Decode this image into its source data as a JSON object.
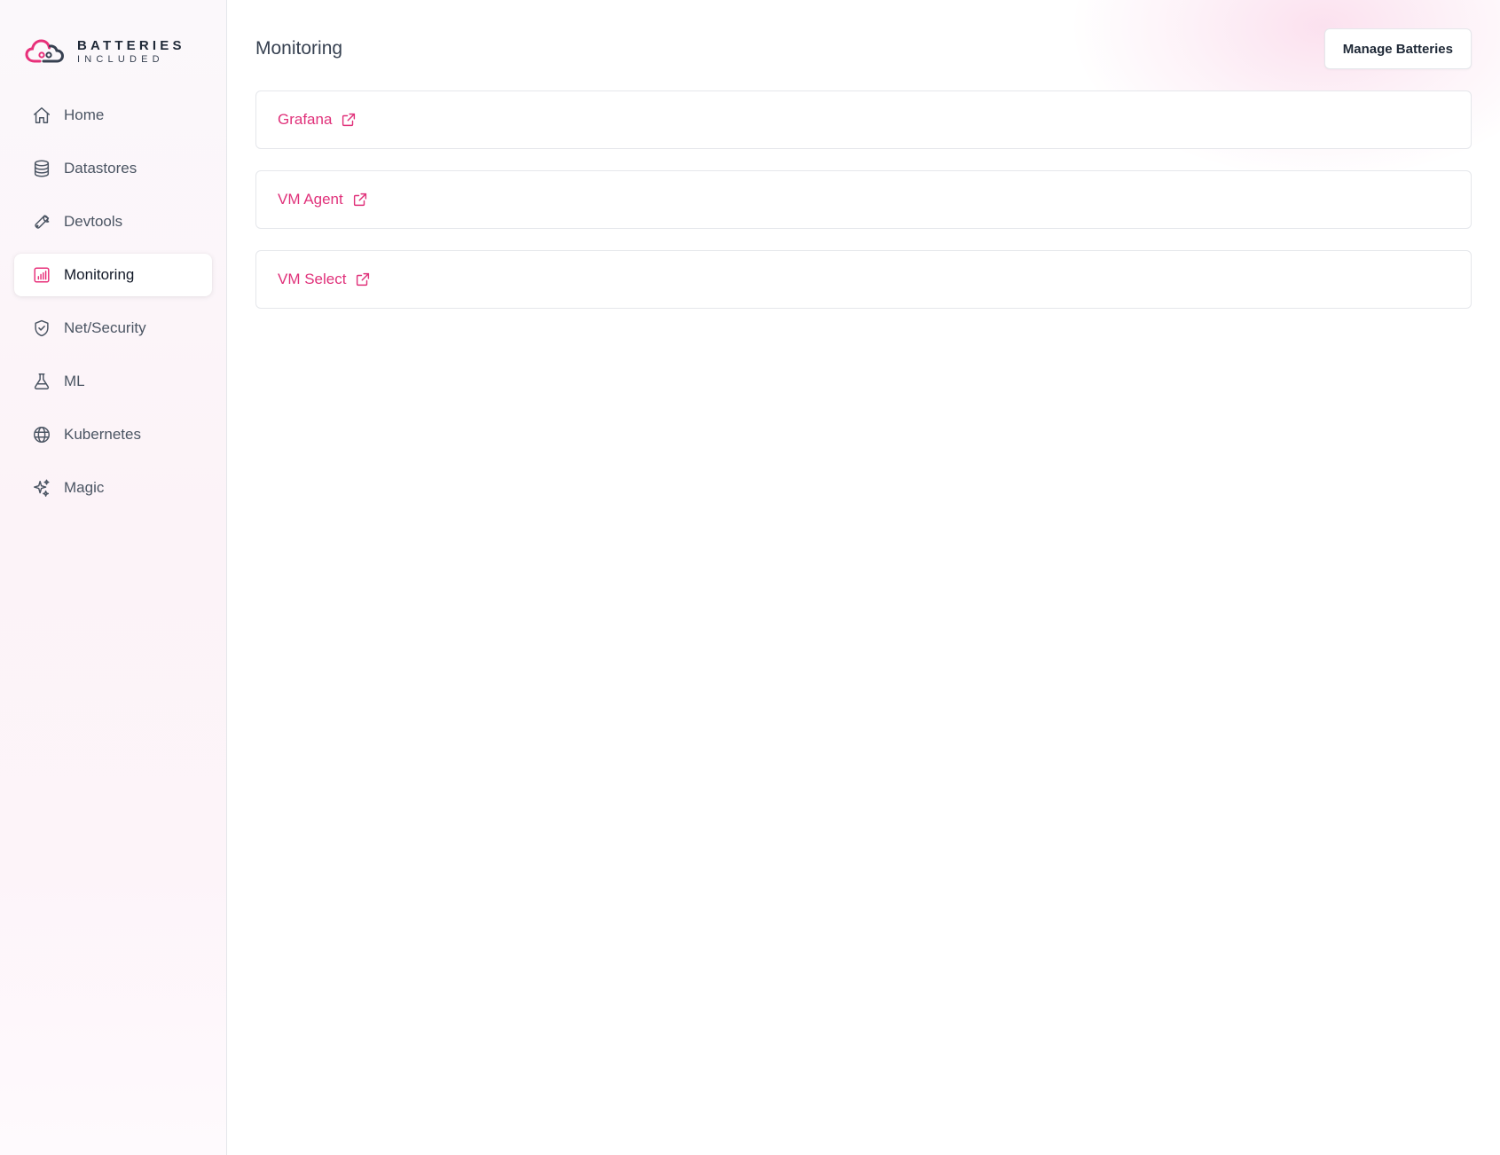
{
  "brand": {
    "line1": "BATTERIES",
    "line2": "INCLUDED",
    "accent_color": "#e8307a",
    "logo_icon": "cloud-logo-icon"
  },
  "sidebar": {
    "items": [
      {
        "label": "Home",
        "icon": "home-icon",
        "active": false
      },
      {
        "label": "Datastores",
        "icon": "database-icon",
        "active": false
      },
      {
        "label": "Devtools",
        "icon": "wrench-icon",
        "active": false
      },
      {
        "label": "Monitoring",
        "icon": "bar-chart-icon",
        "active": true
      },
      {
        "label": "Net/Security",
        "icon": "shield-check-icon",
        "active": false
      },
      {
        "label": "ML",
        "icon": "flask-icon",
        "active": false
      },
      {
        "label": "Kubernetes",
        "icon": "globe-icon",
        "active": false
      },
      {
        "label": "Magic",
        "icon": "sparkles-icon",
        "active": false
      }
    ]
  },
  "header": {
    "title": "Monitoring",
    "manage_button_label": "Manage Batteries"
  },
  "links": [
    {
      "label": "Grafana",
      "icon": "external-link-icon"
    },
    {
      "label": "VM Agent",
      "icon": "external-link-icon"
    },
    {
      "label": "VM Select",
      "icon": "external-link-icon"
    }
  ],
  "colors": {
    "link": "#e0317a",
    "border": "#e5e7eb"
  }
}
